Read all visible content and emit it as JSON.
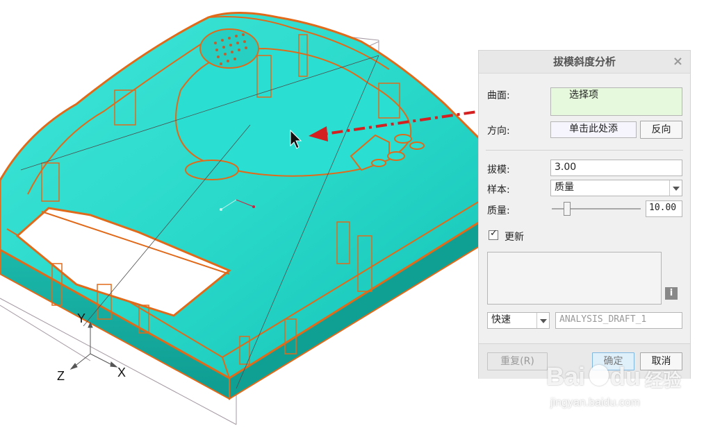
{
  "dialog": {
    "title": "拔模斜度分析",
    "close_glyph": "×",
    "surface_label": "曲面:",
    "surface_value": "选择项",
    "direction_label": "方向:",
    "direction_value": "单击此处添",
    "reverse_button": "反向",
    "draft_label": "拔模:",
    "draft_value": "3.00",
    "sample_label": "样本:",
    "sample_value": "质量",
    "quality_label": "质量:",
    "quality_value": "10.00",
    "quality_slider_fraction": 0.14,
    "update_label": "更新",
    "update_checked": true,
    "info_glyph": "i",
    "mode_value": "快速",
    "analysis_name": "ANALYSIS_DRAFT_1",
    "repeat_button": "重复(R)",
    "ok_button": "确定",
    "cancel_button": "取消"
  },
  "axes": {
    "y": "Y",
    "x": "X",
    "z": "Z"
  },
  "watermark": {
    "brand": "Bai",
    "brand2": "du",
    "cn": "经验",
    "url": "jingyan.baidu.com"
  },
  "colors": {
    "model": "#1ecfc2",
    "model_edge": "#e06a1a",
    "arrow": "#d42020",
    "surface_field": "#e6f9dc"
  },
  "icons": [
    "close-icon",
    "checkbox-icon",
    "info-icon",
    "dropdown-arrow-icon",
    "cursor-icon",
    "red-arrow-icon"
  ]
}
